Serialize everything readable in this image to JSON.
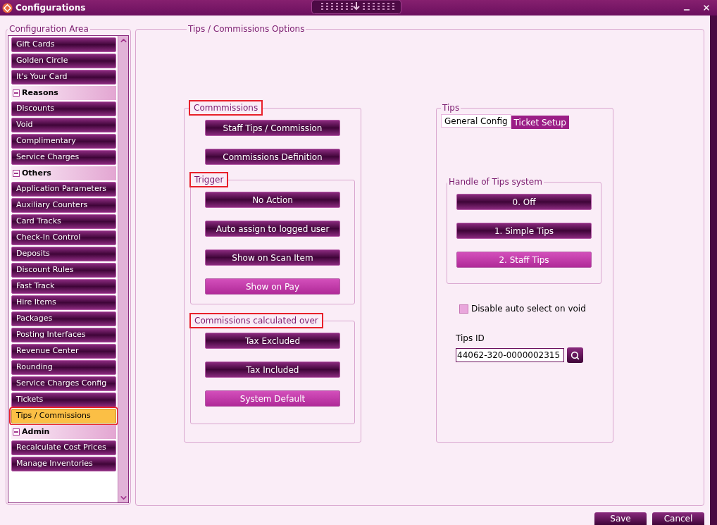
{
  "window": {
    "title": "Configurations"
  },
  "sidebar": {
    "title": "Configuration Area",
    "items": [
      {
        "kind": "item",
        "label": "Gift Cards",
        "selected": false,
        "highlighted": false
      },
      {
        "kind": "item",
        "label": "Golden Circle",
        "selected": false,
        "highlighted": false
      },
      {
        "kind": "item",
        "label": "It's Your Card",
        "selected": false,
        "highlighted": false
      },
      {
        "kind": "header",
        "label": "Reasons",
        "expanded": true
      },
      {
        "kind": "item",
        "label": "Discounts",
        "selected": false,
        "highlighted": false
      },
      {
        "kind": "item",
        "label": "Void",
        "selected": false,
        "highlighted": false
      },
      {
        "kind": "item",
        "label": "Complimentary",
        "selected": false,
        "highlighted": false
      },
      {
        "kind": "item",
        "label": "Service Charges",
        "selected": false,
        "highlighted": false
      },
      {
        "kind": "header",
        "label": "Others",
        "expanded": true
      },
      {
        "kind": "item",
        "label": "Application Parameters",
        "selected": false,
        "highlighted": false
      },
      {
        "kind": "item",
        "label": "Auxiliary Counters",
        "selected": false,
        "highlighted": false
      },
      {
        "kind": "item",
        "label": "Card Tracks",
        "selected": false,
        "highlighted": false
      },
      {
        "kind": "item",
        "label": "Check-In Control",
        "selected": false,
        "highlighted": false
      },
      {
        "kind": "item",
        "label": "Deposits",
        "selected": false,
        "highlighted": false
      },
      {
        "kind": "item",
        "label": "Discount Rules",
        "selected": false,
        "highlighted": false
      },
      {
        "kind": "item",
        "label": "Fast Track",
        "selected": false,
        "highlighted": false
      },
      {
        "kind": "item",
        "label": "Hire Items",
        "selected": false,
        "highlighted": false
      },
      {
        "kind": "item",
        "label": "Packages",
        "selected": false,
        "highlighted": false
      },
      {
        "kind": "item",
        "label": "Posting Interfaces",
        "selected": false,
        "highlighted": false
      },
      {
        "kind": "item",
        "label": "Revenue Center",
        "selected": false,
        "highlighted": false
      },
      {
        "kind": "item",
        "label": "Rounding",
        "selected": false,
        "highlighted": false
      },
      {
        "kind": "item",
        "label": "Service Charges Config",
        "selected": false,
        "highlighted": false
      },
      {
        "kind": "item",
        "label": "Tickets",
        "selected": false,
        "highlighted": false
      },
      {
        "kind": "item",
        "label": "Tips / Commissions",
        "selected": true,
        "highlighted": true
      },
      {
        "kind": "header",
        "label": "Admin",
        "expanded": true
      },
      {
        "kind": "item",
        "label": "Recalculate Cost Prices",
        "selected": false,
        "highlighted": false
      },
      {
        "kind": "item",
        "label": "Manage Inventories",
        "selected": false,
        "highlighted": false
      }
    ]
  },
  "options": {
    "title": "Tips / Commissions Options",
    "commissions": {
      "title": "Commmissions",
      "highlighted": true,
      "buttons": [
        "Staff Tips / Commission",
        "Commissions Definition"
      ],
      "trigger": {
        "title": "Trigger",
        "highlighted": true,
        "options": [
          {
            "label": "No Action",
            "selected": false
          },
          {
            "label": "Auto assign to logged user",
            "selected": false
          },
          {
            "label": "Show on Scan Item",
            "selected": false
          },
          {
            "label": "Show on Pay",
            "selected": true
          }
        ]
      },
      "calculated_over": {
        "title": "Commissions calculated over",
        "highlighted": true,
        "options": [
          {
            "label": "Tax Excluded",
            "selected": false
          },
          {
            "label": "Tax Included",
            "selected": false
          },
          {
            "label": "System Default",
            "selected": true
          }
        ]
      }
    },
    "tips": {
      "title": "Tips",
      "tabs": [
        {
          "label": "General Config",
          "selected": true
        },
        {
          "label": "Ticket Setup",
          "selected": false
        }
      ],
      "handle": {
        "title": "Handle of Tips system",
        "options": [
          {
            "label": "0. Off",
            "selected": false
          },
          {
            "label": "1. Simple Tips",
            "selected": false
          },
          {
            "label": "2. Staff Tips",
            "selected": true
          }
        ]
      },
      "disable_auto_select": {
        "label": "Disable auto select on void",
        "checked": false
      },
      "tips_id": {
        "label": "Tips ID",
        "value": "44062-320-0000002315"
      }
    }
  },
  "footer": {
    "buttons": [
      "Save",
      "Cancel"
    ]
  }
}
